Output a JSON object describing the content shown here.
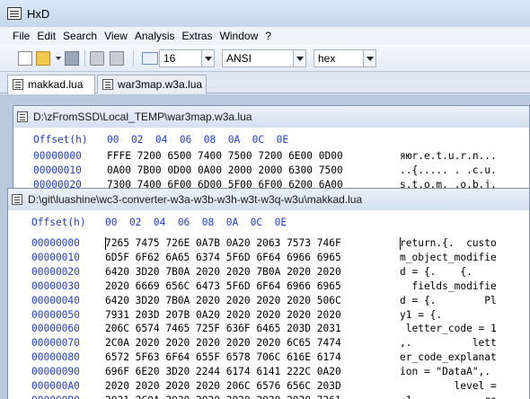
{
  "app": {
    "title": "HxD"
  },
  "menu": [
    "File",
    "Edit",
    "Search",
    "View",
    "Analysis",
    "Extras",
    "Window",
    "?"
  ],
  "toolbar": {
    "bytes_per_row": "16",
    "charset": "ANSI",
    "offset_base": "hex"
  },
  "tabs": [
    {
      "label": "makkad.lua",
      "active": true
    },
    {
      "label": "war3map.w3a.lua",
      "active": false
    }
  ],
  "window1": {
    "path": "D:\\zFromSSD\\Local_TEMP\\war3map.w3a.lua",
    "header_offset": "Offset(h)",
    "header_cols": "00  02  04  06  08  0A  0C  0E",
    "rows": [
      {
        "offset": "00000000",
        "hex": "FFFE 7200 6500 7400 7500 7200 6E00 0D00",
        "text": "яюr.e.t.u.r.n..."
      },
      {
        "offset": "00000010",
        "hex": "0A00 7B00 0D00 0A00 2000 2000 6300 7500",
        "text": "..{..... . .c.u."
      },
      {
        "offset": "00000020",
        "hex": "7300 7400 6F00 6D00 5F00 6F00 6200 6A00",
        "text": "s.t.o.m._.o.b.j."
      }
    ]
  },
  "window2": {
    "path": "D:\\git\\luashine\\wc3-converter-w3a-w3b-w3h-w3t-w3q-w3u\\makkad.lua",
    "header_offset": "Offset(h)",
    "header_cols": "00  02  04  06  08  0A  0C  0E",
    "rows": [
      {
        "offset": "00000000",
        "hex": "7265 7475 726E 0A7B 0A20 2063 7573 746F",
        "text": "return.{.  custo"
      },
      {
        "offset": "00000010",
        "hex": "6D5F 6F62 6A65 6374 5F6D 6F64 6966 6965",
        "text": "m_object_modifie"
      },
      {
        "offset": "00000020",
        "hex": "6420 3D20 7B0A 2020 2020 7B0A 2020 2020",
        "text": "d = {.    {.    "
      },
      {
        "offset": "00000030",
        "hex": "2020 6669 656C 6473 5F6D 6F64 6966 6965",
        "text": "  fields_modifie"
      },
      {
        "offset": "00000040",
        "hex": "6420 3D20 7B0A 2020 2020 2020 2020 506C",
        "text": "d = {.        Pl"
      },
      {
        "offset": "00000050",
        "hex": "7931 203D 207B 0A20 2020 2020 2020 2020",
        "text": "y1 = {.         "
      },
      {
        "offset": "00000060",
        "hex": "206C 6574 7465 725F 636F 6465 203D 2031",
        "text": " letter_code = 1"
      },
      {
        "offset": "00000070",
        "hex": "2C0A 2020 2020 2020 2020 2020 6C65 7474",
        "text": ",.          lett"
      },
      {
        "offset": "00000080",
        "hex": "6572 5F63 6F64 655F 6578 706C 616E 6174",
        "text": "er_code_explanat"
      },
      {
        "offset": "00000090",
        "hex": "696F 6E20 3D20 2244 6174 6141 222C 0A20",
        "text": "ion = \"DataA\",. "
      },
      {
        "offset": "000000A0",
        "hex": "2020 2020 2020 2020 206C 6576 656C 203D",
        "text": "         level ="
      },
      {
        "offset": "000000B0",
        "hex": "2031 2C0A 2020 2020 2020 2020 2020 7261",
        "text": " 1,.          ra"
      }
    ]
  }
}
